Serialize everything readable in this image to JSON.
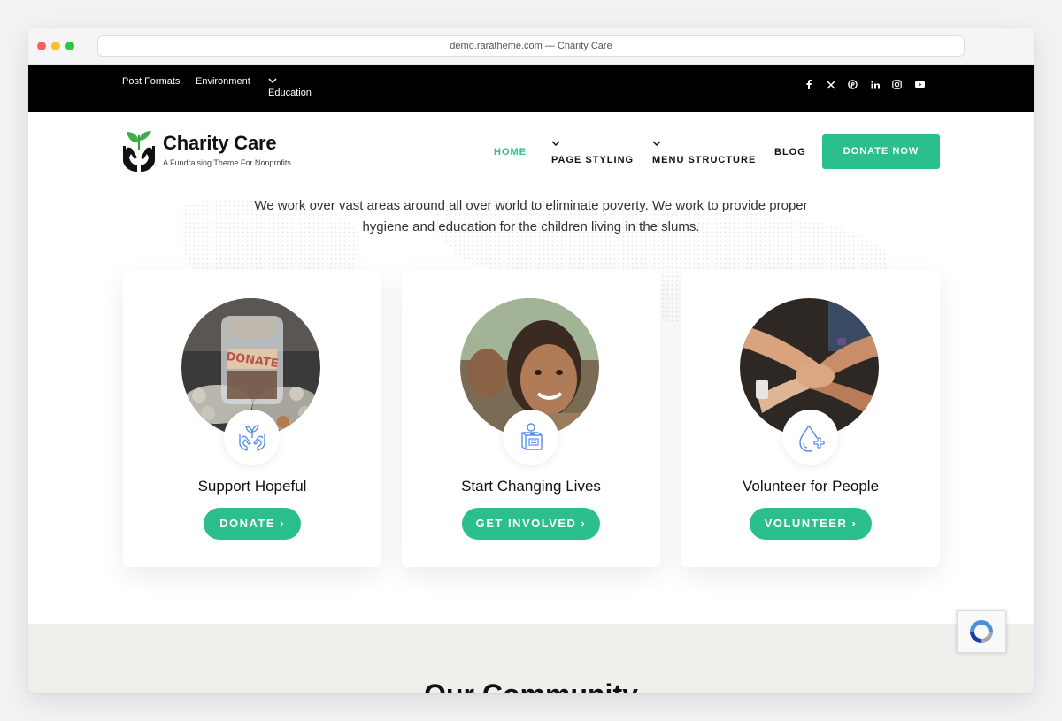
{
  "browser": {
    "address": "demo.raratheme.com — Charity Care"
  },
  "topbar": {
    "nav": [
      {
        "label": "Post Formats"
      },
      {
        "label": "Environment"
      },
      {
        "label": "Education"
      }
    ],
    "social_icons": [
      "facebook-icon",
      "x-icon",
      "pinterest-icon",
      "linkedin-icon",
      "instagram-icon",
      "youtube-icon"
    ]
  },
  "header": {
    "brand_title": "Charity Care",
    "brand_tagline": "A Fundraising Theme For Nonprofits",
    "nav": {
      "home": "HOME",
      "page_styling": "PAGE STYLING",
      "menu_structure": "MENU STRUCTURE",
      "blog": "BLOG"
    },
    "cta": "DONATE NOW"
  },
  "intro": {
    "text": "We work over vast areas around all over world to eliminate poverty. We work to provide proper hygiene and education for the children living in the slums."
  },
  "cards": [
    {
      "title": "Support Hopeful",
      "button": "DONATE ›",
      "icon": "hands-plant-icon",
      "photo": "donation-jar-photo"
    },
    {
      "title": "Start Changing Lives",
      "button": "GET INVOLVED ›",
      "icon": "donation-box-icon",
      "photo": "smiling-child-photo"
    },
    {
      "title": "Volunteer for People",
      "button": "VOLUNTEER ›",
      "icon": "blood-drop-plus-icon",
      "photo": "stacked-hands-photo"
    }
  ],
  "community": {
    "title": "Our Community"
  },
  "colors": {
    "accent": "#2bbf8e",
    "topbar": "#000000",
    "community_bg": "#f1efeb"
  }
}
